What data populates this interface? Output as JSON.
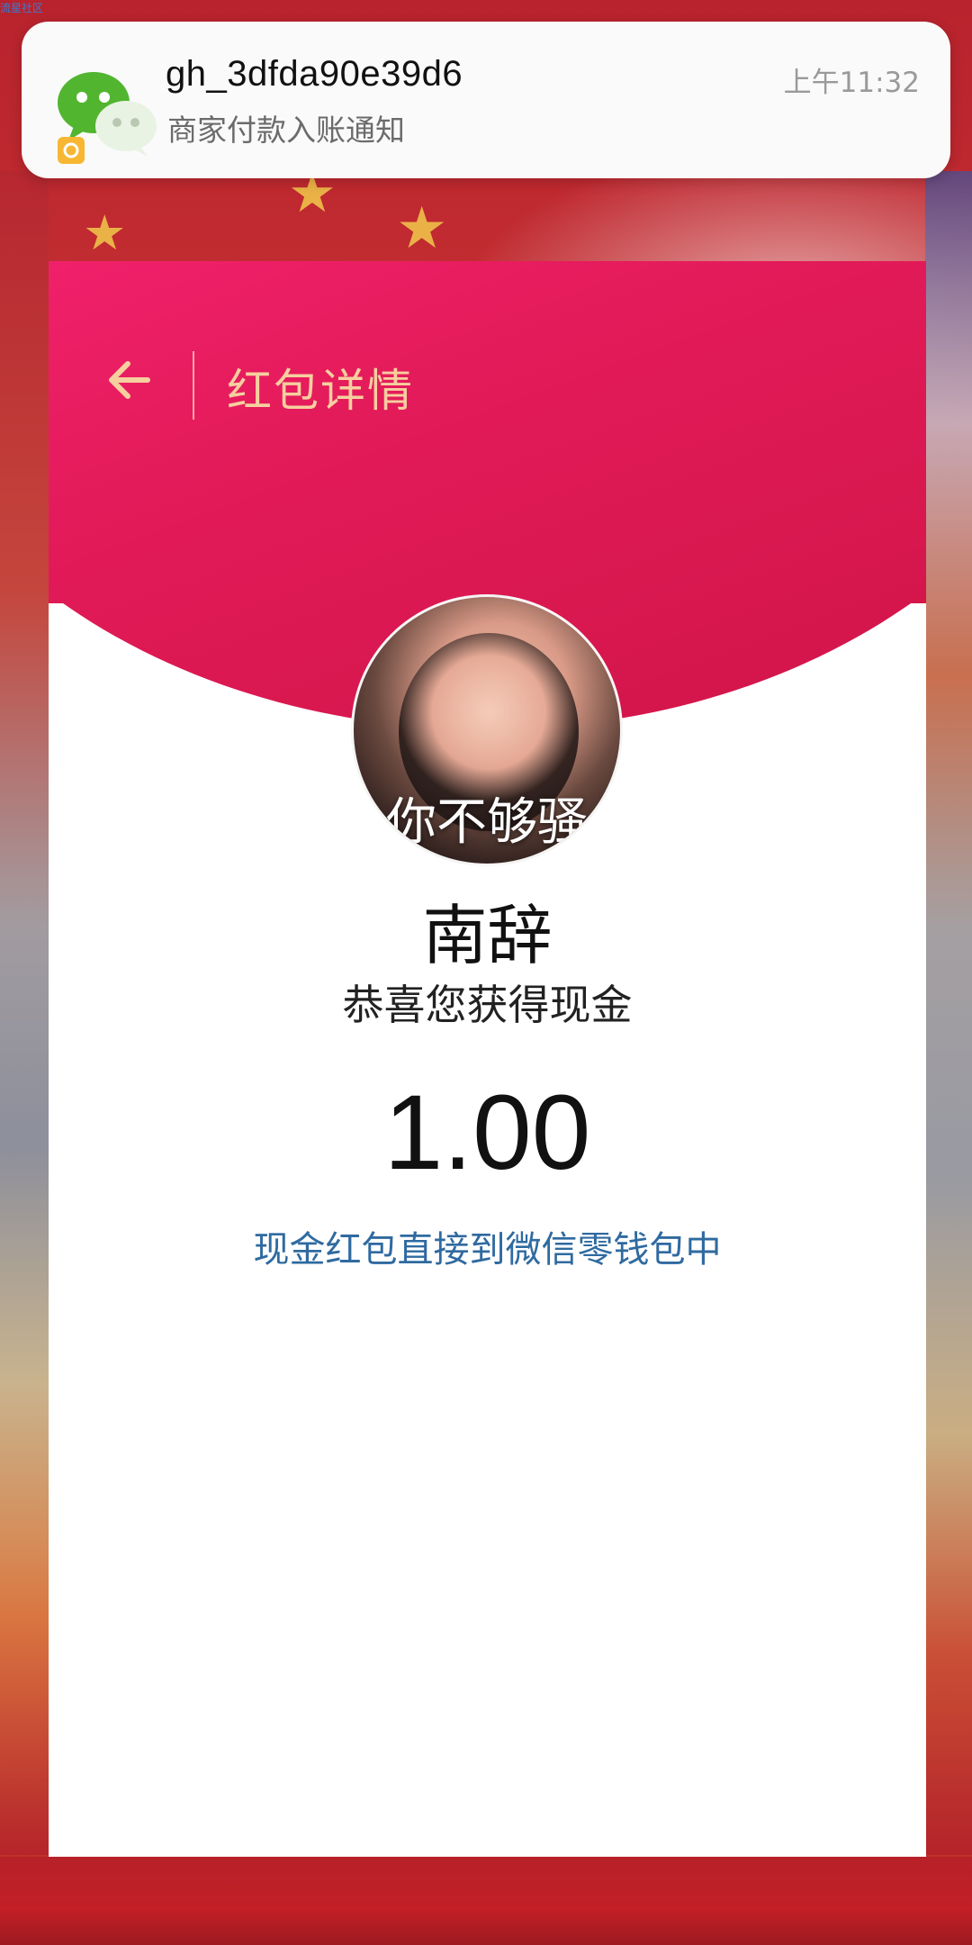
{
  "watermark": "流星社区",
  "notification": {
    "app_icon": "wechat-icon",
    "sender": "gh_3dfda90e39d6",
    "message": "商家付款入账通知",
    "time": "上午11:32"
  },
  "header": {
    "back_icon": "arrow-left-icon",
    "title": "红包详情"
  },
  "red_packet": {
    "avatar_caption": "你不够骚",
    "sender_name": "南辞",
    "greeting": "恭喜您获得现金",
    "amount": "1.00",
    "note": "现金红包直接到微信零钱包中"
  },
  "colors": {
    "header_red": "#e11a57",
    "title_gold": "#f6cf9f",
    "note_blue": "#2f6aa0"
  }
}
